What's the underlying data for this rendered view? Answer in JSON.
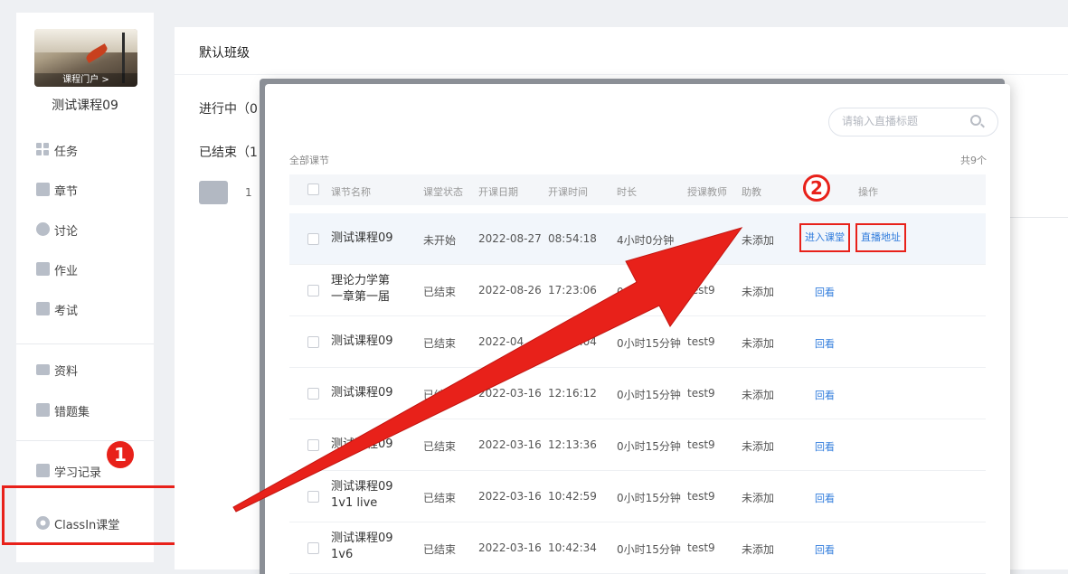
{
  "sidebar": {
    "course_image_tag": "课程门户 >",
    "course_title": "测试课程09",
    "items": [
      {
        "label": "任务",
        "icon": "grid-icon"
      },
      {
        "label": "章节",
        "icon": "list-icon"
      },
      {
        "label": "讨论",
        "icon": "chat-bubble-icon"
      },
      {
        "label": "作业",
        "icon": "edit-icon"
      },
      {
        "label": "考试",
        "icon": "exam-icon"
      },
      {
        "label": "资料",
        "icon": "folder-icon"
      },
      {
        "label": "错题集",
        "icon": "wrong-set-icon"
      },
      {
        "label": "学习记录",
        "icon": "record-icon"
      },
      {
        "label": "ClassIn课堂",
        "icon": "gear-icon"
      }
    ]
  },
  "background": {
    "title": "默认班级",
    "in_progress": "进行中（0",
    "finished": "已结束（1",
    "item_number": "1"
  },
  "popup": {
    "search_placeholder": "请输入直播标题",
    "all_label": "全部课节",
    "total": "共9个",
    "headers": {
      "name": "课节名称",
      "status": "课堂状态",
      "date": "开课日期",
      "time": "开课时间",
      "duration": "时长",
      "teacher": "授课教师",
      "assistant": "助教",
      "action": "操作"
    },
    "rows": [
      {
        "name": "测试课程09",
        "status": "未开始",
        "date": "2022-08-27",
        "time": "08:54:18",
        "duration": "4小时0分钟",
        "teacher": "",
        "assistant": "未添加",
        "action1": "进入课堂",
        "action2": "直播地址"
      },
      {
        "name": "理论力学第一章第一届",
        "status": "已结束",
        "date": "2022-08-26",
        "time": "17:23:06",
        "duration": "0小时0分钟",
        "teacher": "test9",
        "assistant": "未添加",
        "action1": "回看"
      },
      {
        "name": "测试课程09",
        "status": "已结束",
        "date": "2022-04",
        "time": "18:44:04",
        "duration": "0小时15分钟",
        "teacher": "test9",
        "assistant": "未添加",
        "action1": "回看"
      },
      {
        "name": "测试课程09",
        "status": "已结束",
        "date": "2022-03-16",
        "time": "12:16:12",
        "duration": "0小时15分钟",
        "teacher": "test9",
        "assistant": "未添加",
        "action1": "回看"
      },
      {
        "name": "测试课程09",
        "status": "已结束",
        "date": "2022-03-16",
        "time": "12:13:36",
        "duration": "0小时15分钟",
        "teacher": "test9",
        "assistant": "未添加",
        "action1": "回看"
      },
      {
        "name": "测试课程09 1v1 live",
        "status": "已结束",
        "date": "2022-03-16",
        "time": "10:42:59",
        "duration": "0小时15分钟",
        "teacher": "test9",
        "assistant": "未添加",
        "action1": "回看"
      },
      {
        "name": "测试课程09 1v6",
        "status": "已结束",
        "date": "2022-03-16",
        "time": "10:42:34",
        "duration": "0小时15分钟",
        "teacher": "test9",
        "assistant": "未添加",
        "action1": "回看"
      }
    ]
  },
  "annotations": {
    "badge1": "1",
    "badge2": "2",
    "arrow_color": "#e8211a"
  }
}
